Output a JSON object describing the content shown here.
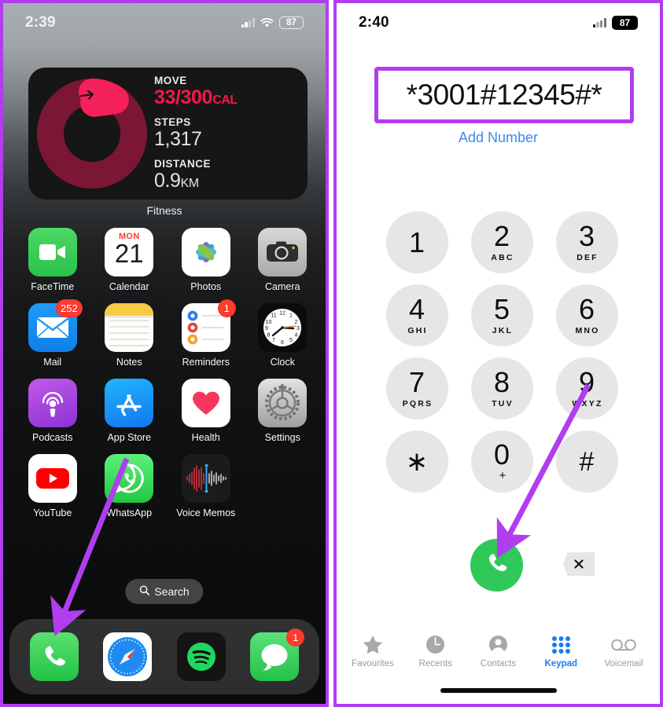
{
  "accent": {
    "annotation_purple": "#b13df0",
    "ios_blue": "#1b7ced",
    "call_green": "#31c85a",
    "badge_red": "#ff3b30",
    "move_red": "#f3164f"
  },
  "home_screen": {
    "status_bar": {
      "time": "2:39",
      "battery": "87",
      "signal_icon": "cellular-bars-icon",
      "wifi_icon": "wifi-icon",
      "battery_icon": "battery-icon"
    },
    "widget": {
      "caption": "Fitness",
      "ring_icon": "activity-ring-icon",
      "arrow_icon": "arrow-right-icon",
      "metrics": [
        {
          "label": "MOVE",
          "value": "33/300",
          "unit": "CAL",
          "accent": true
        },
        {
          "label": "STEPS",
          "value": "1,317",
          "unit": "",
          "accent": false
        },
        {
          "label": "DISTANCE",
          "value": "0.9",
          "unit": "KM",
          "accent": false
        }
      ]
    },
    "apps": [
      {
        "label": "FaceTime",
        "icon": "facetime-icon",
        "badge": ""
      },
      {
        "label": "Calendar",
        "icon": "calendar-icon",
        "badge": "",
        "day_name": "MON",
        "day_number": "21"
      },
      {
        "label": "Photos",
        "icon": "photos-icon",
        "badge": ""
      },
      {
        "label": "Camera",
        "icon": "camera-icon",
        "badge": ""
      },
      {
        "label": "Mail",
        "icon": "mail-icon",
        "badge": "252"
      },
      {
        "label": "Notes",
        "icon": "notes-icon",
        "badge": ""
      },
      {
        "label": "Reminders",
        "icon": "reminders-icon",
        "badge": "1"
      },
      {
        "label": "Clock",
        "icon": "clock-icon",
        "badge": ""
      },
      {
        "label": "Podcasts",
        "icon": "podcasts-icon",
        "badge": ""
      },
      {
        "label": "App Store",
        "icon": "app-store-icon",
        "badge": ""
      },
      {
        "label": "Health",
        "icon": "health-icon",
        "badge": ""
      },
      {
        "label": "Settings",
        "icon": "settings-icon",
        "badge": ""
      },
      {
        "label": "YouTube",
        "icon": "youtube-icon",
        "badge": ""
      },
      {
        "label": "WhatsApp",
        "icon": "whatsapp-icon",
        "badge": ""
      },
      {
        "label": "Voice Memos",
        "icon": "voice-memos-icon",
        "badge": ""
      }
    ],
    "search": {
      "label": "Search",
      "icon": "search-icon"
    },
    "dock": [
      {
        "label": "Phone",
        "icon": "phone-icon",
        "badge": ""
      },
      {
        "label": "Safari",
        "icon": "safari-icon",
        "badge": ""
      },
      {
        "label": "Spotify",
        "icon": "spotify-icon",
        "badge": ""
      },
      {
        "label": "Messages",
        "icon": "messages-icon",
        "badge": "1"
      }
    ]
  },
  "dialer_screen": {
    "status_bar": {
      "time": "2:40",
      "battery": "87",
      "signal_icon": "cellular-bars-icon",
      "battery_icon": "battery-icon"
    },
    "dialed_number": "*3001#12345#*",
    "add_number_label": "Add Number",
    "keys": [
      {
        "digit": "1",
        "letters": ""
      },
      {
        "digit": "2",
        "letters": "ABC"
      },
      {
        "digit": "3",
        "letters": "DEF"
      },
      {
        "digit": "4",
        "letters": "GHI"
      },
      {
        "digit": "5",
        "letters": "JKL"
      },
      {
        "digit": "6",
        "letters": "MNO"
      },
      {
        "digit": "7",
        "letters": "PQRS"
      },
      {
        "digit": "8",
        "letters": "TUV"
      },
      {
        "digit": "9",
        "letters": "WXYZ"
      },
      {
        "digit": "∗",
        "letters": ""
      },
      {
        "digit": "0",
        "letters": "+"
      },
      {
        "digit": "#",
        "letters": ""
      }
    ],
    "call_button_icon": "phone-handset-icon",
    "delete_button_icon": "backspace-icon",
    "tabs": [
      {
        "label": "Favourites",
        "icon": "star-icon",
        "active": false
      },
      {
        "label": "Recents",
        "icon": "clock-icon",
        "active": false
      },
      {
        "label": "Contacts",
        "icon": "person-circle-icon",
        "active": false
      },
      {
        "label": "Keypad",
        "icon": "keypad-grid-icon",
        "active": true
      },
      {
        "label": "Voicemail",
        "icon": "voicemail-icon",
        "active": false
      }
    ]
  },
  "annotations": [
    {
      "name": "arrow-to-phone-dock",
      "from": "App Store area",
      "to": "Phone app in dock"
    },
    {
      "name": "arrow-to-call-button",
      "from": "9 key",
      "to": "green call button"
    }
  ]
}
